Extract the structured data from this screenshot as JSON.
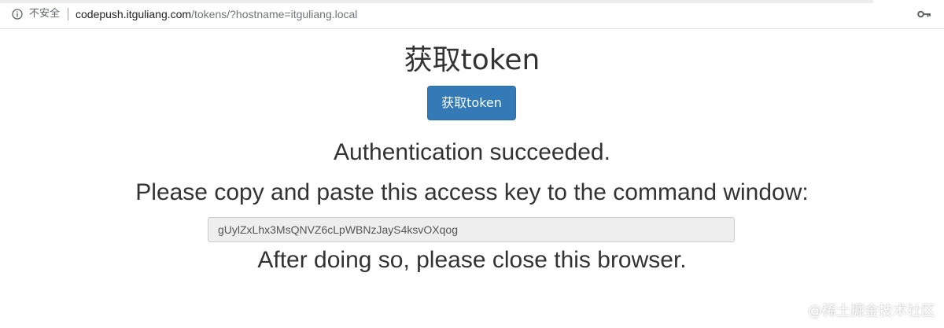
{
  "browser": {
    "security_label": "不安全",
    "url_host": "codepush.itguliang.com",
    "url_path": "/tokens/?hostname=itguliang.local",
    "icons": {
      "info": "info-icon",
      "key": "key-icon"
    }
  },
  "page": {
    "title": "获取token",
    "button_label": "获取token",
    "auth_message": "Authentication succeeded.",
    "copy_instruction": "Please copy and paste this access key to the command window:",
    "access_key": "gUylZxLhx3MsQNVZ6cLpWBNzJayS4ksvOXqog",
    "close_message": "After doing so, please close this browser."
  },
  "watermark": "@稀土掘金技术社区",
  "colors": {
    "primary_button": "#337ab7",
    "text": "#333333",
    "input_bg": "#eeeeee"
  }
}
